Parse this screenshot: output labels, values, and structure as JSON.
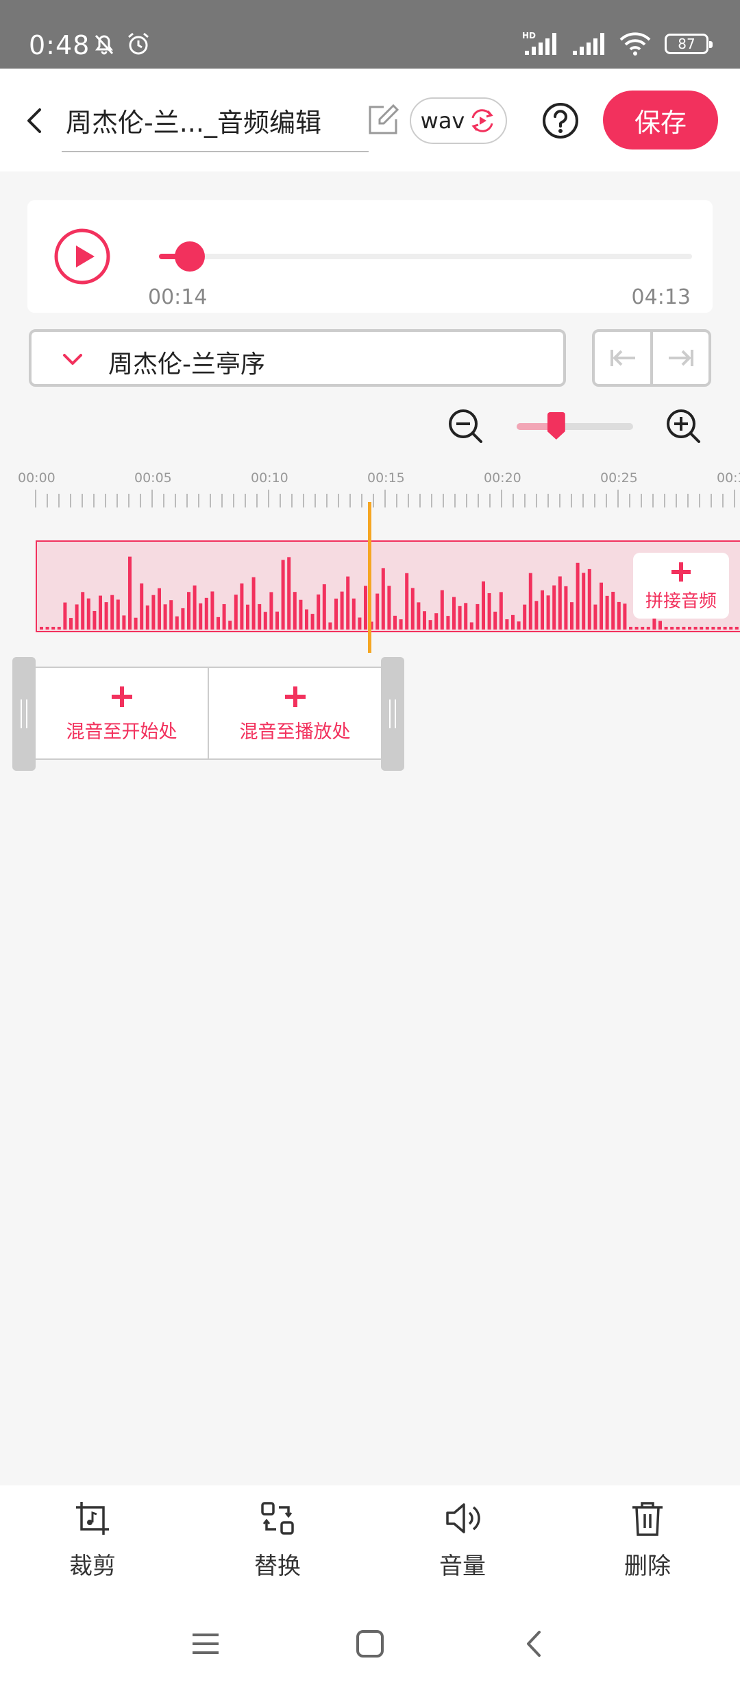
{
  "status_bar": {
    "time": "0:48",
    "network_tag": "HD",
    "battery": "87"
  },
  "app_bar": {
    "title": "周杰伦-兰..._音频编辑",
    "format": "wav",
    "save_label": "保存"
  },
  "player": {
    "current_time": "00:14",
    "total_time": "04:13",
    "progress": 0.058
  },
  "track": {
    "name": "周杰伦-兰亭序"
  },
  "zoom": {
    "level": 0.34
  },
  "ruler": {
    "labels": [
      "00:00",
      "00:05",
      "00:10",
      "00:15",
      "00:20",
      "00:25",
      "00:3"
    ]
  },
  "waveform": {
    "splice_label": "拼接音频"
  },
  "mix": {
    "start_label": "混音至开始处",
    "playhead_label": "混音至播放处"
  },
  "tools": [
    {
      "label": "裁剪",
      "icon": "crop-music-icon"
    },
    {
      "label": "替换",
      "icon": "replace-icon"
    },
    {
      "label": "音量",
      "icon": "volume-icon"
    },
    {
      "label": "删除",
      "icon": "trash-icon"
    }
  ],
  "colors": {
    "accent": "#f2315d",
    "playhead": "#f5a623",
    "wave_bg": "#f6dbe1"
  }
}
